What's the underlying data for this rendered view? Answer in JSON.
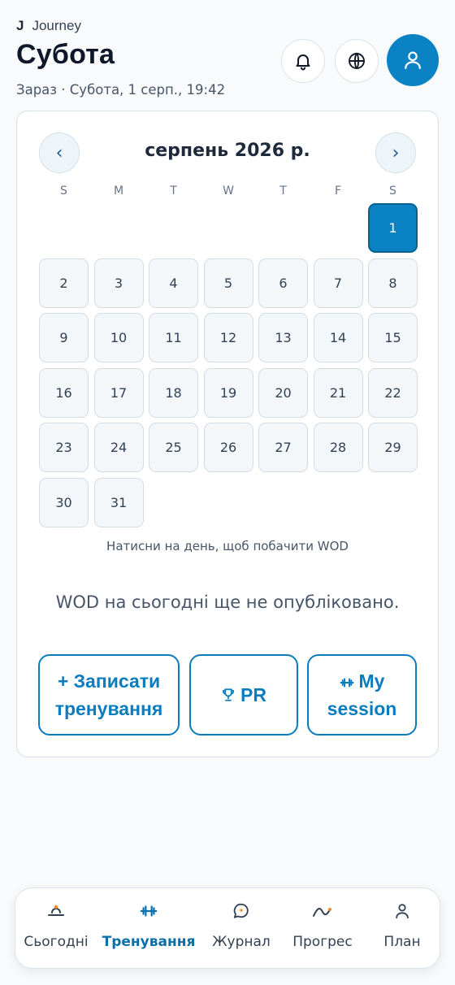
{
  "header": {
    "brand_logo": "J",
    "brand_name": "Journey",
    "title": "Субота",
    "subtitle": "Зараз · Субота, 1 серп., 19:42",
    "icons": [
      "bell-icon",
      "globe-icon",
      "user-icon"
    ]
  },
  "calendar": {
    "prev_label": "‹",
    "next_label": "›",
    "month_title": "серпень 2026 р.",
    "weekdays": [
      "S",
      "M",
      "T",
      "W",
      "T",
      "F",
      "S"
    ],
    "first_weekday_index": 6,
    "days": [
      "1",
      "2",
      "3",
      "4",
      "5",
      "6",
      "7",
      "8",
      "9",
      "10",
      "11",
      "12",
      "13",
      "14",
      "15",
      "16",
      "17",
      "18",
      "19",
      "20",
      "21",
      "22",
      "23",
      "24",
      "25",
      "26",
      "27",
      "28",
      "29",
      "30",
      "31"
    ],
    "selected_day": "1",
    "hint": "Натисни на день, щоб побачити WOD"
  },
  "wod": {
    "empty_message": "WOD на сьогодні ще не опубліковано."
  },
  "actions": {
    "log_workout_line1": "+ Записати",
    "log_workout_line2": "тренування",
    "pr_label": "PR",
    "session_line1": "My",
    "session_line2": "session"
  },
  "bottom_nav": {
    "items": [
      {
        "label": "Сьогодні",
        "icon": "sunrise-icon"
      },
      {
        "label": "Тренування",
        "icon": "dumbbell-icon",
        "active": true
      },
      {
        "label": "Журнал",
        "icon": "chat-bubble-icon"
      },
      {
        "label": "Прогрес",
        "icon": "trend-icon"
      },
      {
        "label": "План",
        "icon": "person-icon"
      }
    ]
  },
  "colors": {
    "accent": "#0b82c4",
    "accent_dark": "#0b6fa8",
    "nav_icon_orange": "#f08a24"
  }
}
